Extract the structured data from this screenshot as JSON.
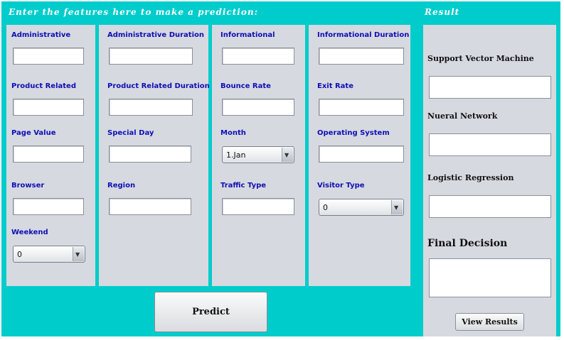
{
  "form": {
    "heading": "Enter the features here to make a prediction:",
    "columns": [
      {
        "fields": [
          {
            "label": "Administrative",
            "value": ""
          },
          {
            "label": "Product Related",
            "value": ""
          },
          {
            "label": "Page Value",
            "value": ""
          },
          {
            "label": "Browser",
            "value": ""
          },
          {
            "label": "Weekend",
            "selected": "0"
          }
        ]
      },
      {
        "fields": [
          {
            "label": "Administrative Duration",
            "value": ""
          },
          {
            "label": "Product Related Duration",
            "value": ""
          },
          {
            "label": "Special Day",
            "value": ""
          },
          {
            "label": "Region",
            "value": ""
          }
        ]
      },
      {
        "fields": [
          {
            "label": "Informational",
            "value": ""
          },
          {
            "label": "Bounce Rate",
            "value": ""
          },
          {
            "label": "Month",
            "selected": "1.Jan"
          },
          {
            "label": "Traffic Type",
            "value": ""
          }
        ]
      },
      {
        "fields": [
          {
            "label": "Informational Duration",
            "value": ""
          },
          {
            "label": "Exit Rate",
            "value": ""
          },
          {
            "label": "Operating System",
            "value": ""
          },
          {
            "label": "Visitor Type",
            "selected": "0"
          }
        ]
      }
    ],
    "predict_label": "Predict"
  },
  "result": {
    "heading": "Result",
    "items": [
      {
        "label": "Support Vector Machine",
        "value": ""
      },
      {
        "label": "Nueral Network",
        "value": ""
      },
      {
        "label": "Logistic Regression",
        "value": ""
      },
      {
        "label": "Final Decision",
        "value": ""
      }
    ],
    "view_label": "View Results"
  }
}
